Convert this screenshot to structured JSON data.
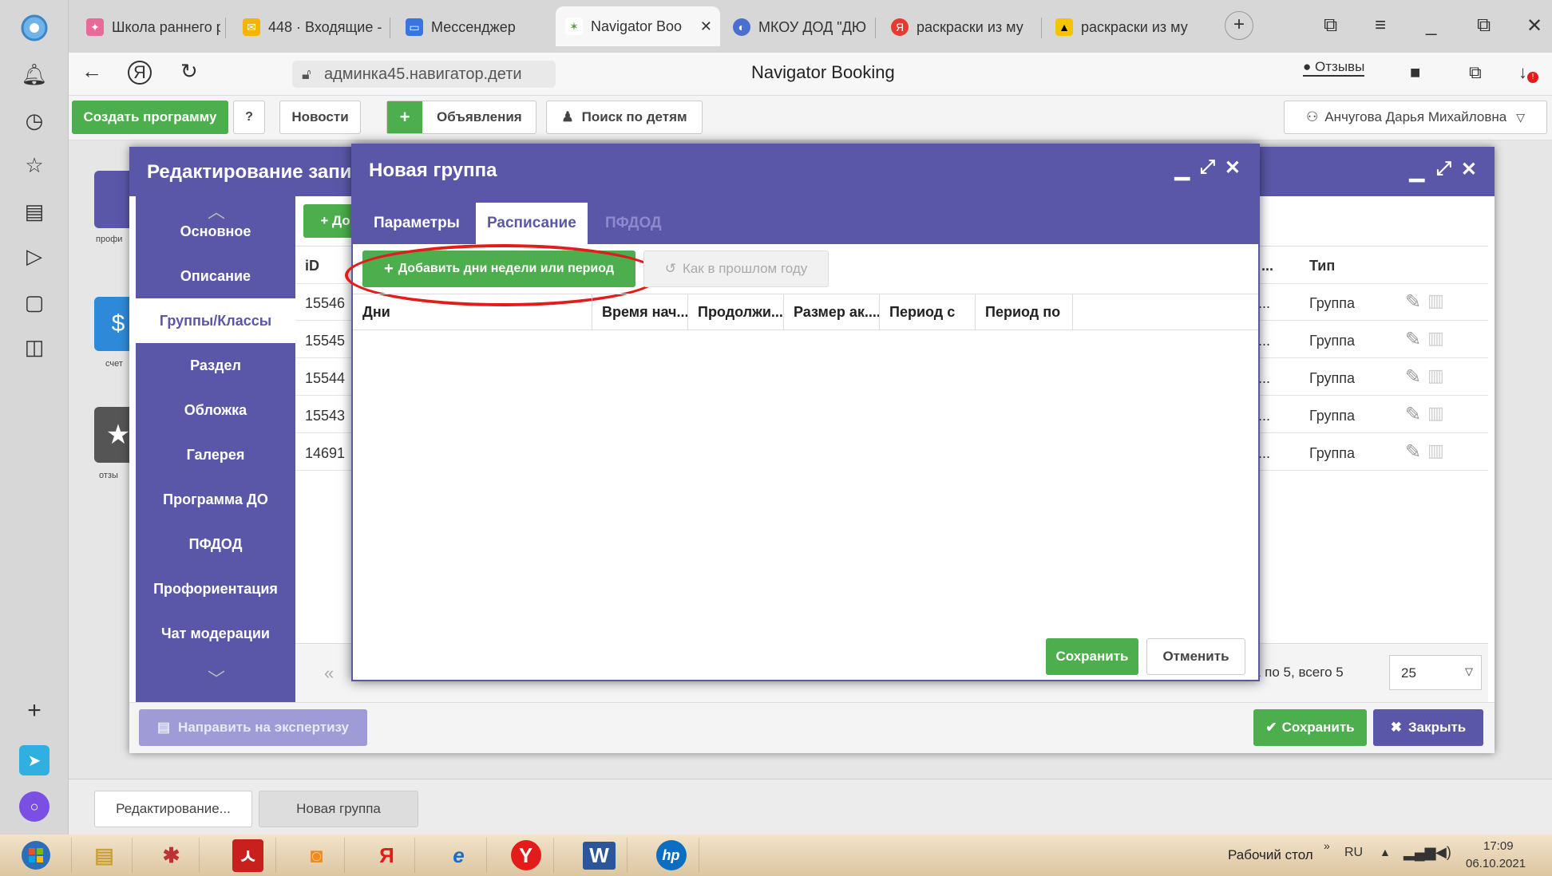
{
  "browser": {
    "tabs": [
      {
        "label": "Школа раннего р",
        "icon": "kids-school-icon"
      },
      {
        "label": "448 · Входящие -",
        "icon": "mail-icon"
      },
      {
        "label": "Мессенджер",
        "icon": "messenger-icon"
      },
      {
        "label": "Navigator Boo",
        "icon": "navigator-icon",
        "active": true
      },
      {
        "label": "МКОУ ДОД \"ДЮ",
        "icon": "school-icon"
      },
      {
        "label": "раскраски из му",
        "icon": "yandex-icon"
      },
      {
        "label": "раскраски из му",
        "icon": "image-icon"
      }
    ],
    "url": "админка45.навигатор.дети",
    "page_title": "Navigator Booking",
    "reviews_label": "Отзывы"
  },
  "toolbar": {
    "create_program": "Создать программу",
    "news": "Новости",
    "announcements": "Объявления",
    "search_children": "Поиск по детям",
    "user_name": "Анчугова Дарья Михайловна"
  },
  "left_widgets": [
    "профи",
    "счет",
    "отзы"
  ],
  "outer_modal": {
    "title": "Редактирование запи",
    "add_label": "До",
    "nav": [
      "Основное",
      "Описание",
      "Группы/Классы",
      "Раздел",
      "Обложка",
      "Галерея",
      "Программа ДО",
      "ПФДОД",
      "Профориентация",
      "Чат модерации"
    ],
    "columns": {
      "id": "iD",
      "partial": "к ...",
      "type": "Тип"
    },
    "rows": [
      {
        "id": "15546",
        "partial": "о...",
        "type": "Группа"
      },
      {
        "id": "15545",
        "partial": "о...",
        "type": "Группа"
      },
      {
        "id": "15544",
        "partial": "о...",
        "type": "Группа"
      },
      {
        "id": "15543",
        "partial": "о...",
        "type": "Группа"
      },
      {
        "id": "14691",
        "partial": "о...",
        "type": "Группа"
      }
    ],
    "pagination_text": "1 по 5, всего 5",
    "page_size": "25",
    "expertise_button": "Направить на экспертизу",
    "save_button": "Сохранить",
    "close_button": "Закрыть"
  },
  "inner_modal": {
    "title": "Новая группа",
    "tabs": [
      "Параметры",
      "Расписание",
      "ПФДОД"
    ],
    "add_days_button": "Добавить дни недели или период",
    "last_year_button": "Как в прошлом году",
    "columns": [
      "Дни",
      "Время нач...",
      "Продолжи...",
      "Размер ак....",
      "Период с",
      "Период по"
    ],
    "save_button": "Сохранить",
    "cancel_button": "Отменить"
  },
  "bottom_tasks": [
    "Редактирование...",
    "Новая группа"
  ],
  "taskbar": {
    "desktop_label": "Рабочий стол",
    "lang": "RU",
    "time": "17:09",
    "date": "06.10.2021"
  },
  "colors": {
    "primary": "#5a57a8",
    "success": "#4cae4c",
    "highlight": "#e31b1b"
  }
}
